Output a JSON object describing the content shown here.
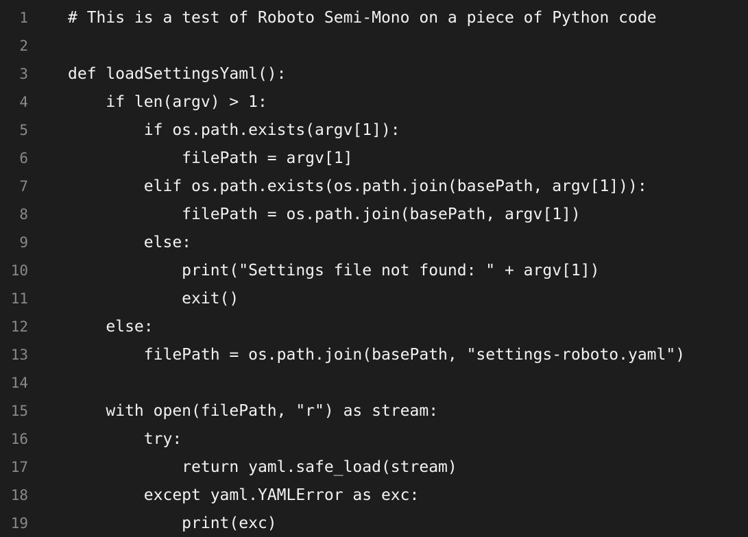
{
  "editor": {
    "lines": [
      {
        "number": "1",
        "text": "# This is a test of Roboto Semi-Mono on a piece of Python code"
      },
      {
        "number": "2",
        "text": ""
      },
      {
        "number": "3",
        "text": "def loadSettingsYaml():"
      },
      {
        "number": "4",
        "text": "    if len(argv) > 1:"
      },
      {
        "number": "5",
        "text": "        if os.path.exists(argv[1]):"
      },
      {
        "number": "6",
        "text": "            filePath = argv[1]"
      },
      {
        "number": "7",
        "text": "        elif os.path.exists(os.path.join(basePath, argv[1])):"
      },
      {
        "number": "8",
        "text": "            filePath = os.path.join(basePath, argv[1])"
      },
      {
        "number": "9",
        "text": "        else:"
      },
      {
        "number": "10",
        "text": "            print(\"Settings file not found: \" + argv[1])"
      },
      {
        "number": "11",
        "text": "            exit()"
      },
      {
        "number": "12",
        "text": "    else:"
      },
      {
        "number": "13",
        "text": "        filePath = os.path.join(basePath, \"settings-roboto.yaml\")"
      },
      {
        "number": "14",
        "text": ""
      },
      {
        "number": "15",
        "text": "    with open(filePath, \"r\") as stream:"
      },
      {
        "number": "16",
        "text": "        try:"
      },
      {
        "number": "17",
        "text": "            return yaml.safe_load(stream)"
      },
      {
        "number": "18",
        "text": "        except yaml.YAMLError as exc:"
      },
      {
        "number": "19",
        "text": "            print(exc)"
      }
    ]
  }
}
